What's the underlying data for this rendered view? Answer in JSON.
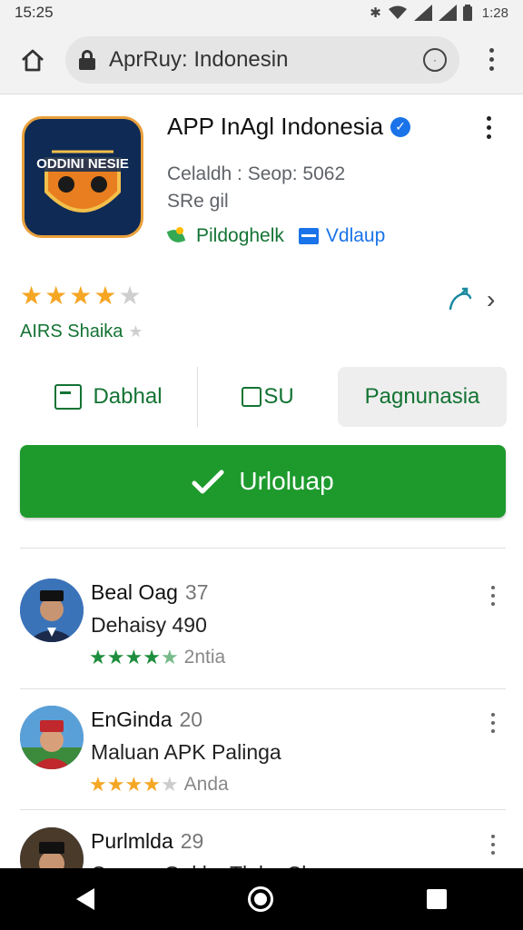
{
  "status_bar": {
    "time_left": "15:25",
    "time_right": "1:28",
    "icons": [
      "bluetooth-icon",
      "wifi-icon",
      "signal-icon",
      "signal-icon",
      "battery-icon"
    ]
  },
  "browser": {
    "url": "AprRuy: Indonesin",
    "home_icon": "home-icon",
    "lock_icon": "lock-icon",
    "reload_icon": "reload-icon",
    "menu_icon": "more-vert-icon"
  },
  "app": {
    "title": "APP InAgl Indonesia",
    "icon_text": "ODDINI NESIE",
    "meta_line1": "Celaldh : Seop: 5062",
    "meta_line2": "SRe gil",
    "tag1": "Pildoghelk",
    "tag2": "Vdlaup",
    "colors": {
      "accent": "#137333",
      "install": "#1e9a2d",
      "verified": "#1a73e8"
    }
  },
  "rating": {
    "stars": 4,
    "max": 5,
    "label": "AIRS Shaika"
  },
  "actions": {
    "tab1": "Dabhal",
    "tab2": "SU",
    "tab3": "Pagnunasia",
    "install": "Urloluap"
  },
  "reviews": [
    {
      "name": "Beal Oag",
      "count": "37",
      "text": "Dehaisy 490",
      "stars": 4.5,
      "star_color": "green",
      "when": "2ntia"
    },
    {
      "name": "EnGinda",
      "count": "20",
      "text": "Maluan APK Palinga",
      "stars": 4,
      "star_color": "gold",
      "when": "Anda"
    },
    {
      "name": "Purlmlda",
      "count": "29",
      "text": "Coeem Gakka Tlakp Cb",
      "stars": 0,
      "star_color": "gold",
      "when": ""
    }
  ]
}
